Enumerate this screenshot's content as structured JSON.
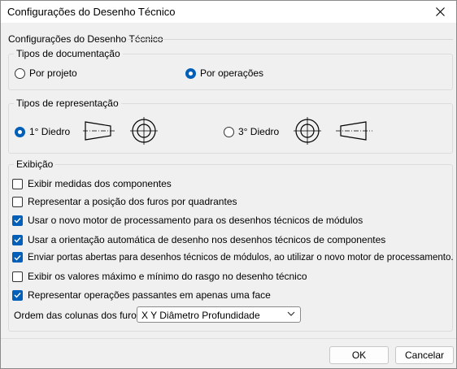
{
  "window": {
    "title": "Configurações do Desenho Técnico"
  },
  "section_title": "Configurações do Desenho Técnico",
  "doc_types": {
    "title": "Tipos de documentação",
    "options": [
      {
        "label": "Por projeto",
        "selected": false
      },
      {
        "label": "Por operações",
        "selected": true
      }
    ]
  },
  "rep_types": {
    "title": "Tipos de representação",
    "options": [
      {
        "label": "1° Diedro",
        "selected": true
      },
      {
        "label": "3° Diedro",
        "selected": false
      }
    ]
  },
  "display": {
    "title": "Exibição",
    "checkboxes": [
      {
        "label": "Exibir medidas dos componentes",
        "checked": false
      },
      {
        "label": "Representar a posição dos furos por quadrantes",
        "checked": false
      },
      {
        "label": "Usar o novo motor de processamento para os desenhos técnicos de módulos",
        "checked": true
      },
      {
        "label": "Usar a orientação automática de desenho nos desenhos técnicos de componentes",
        "checked": true
      },
      {
        "label": "Enviar portas abertas para desenhos técnicos de módulos, ao utilizar o novo motor de processamento.",
        "checked": true
      },
      {
        "label": "Exibir os valores máximo e mínimo do rasgo no desenho técnico",
        "checked": false
      },
      {
        "label": "Representar operações passantes em apenas uma face",
        "checked": true
      }
    ],
    "hole_order": {
      "label": "Ordem das colunas dos furos",
      "value": "X Y Diâmetro Profundidade"
    }
  },
  "buttons": {
    "ok": "OK",
    "cancel": "Cancelar"
  },
  "colors": {
    "accent": "#005fb8"
  },
  "icons": [
    "close-icon",
    "chevron-down-icon",
    "check-icon",
    "first-angle-projection-symbol",
    "third-angle-projection-symbol"
  ]
}
